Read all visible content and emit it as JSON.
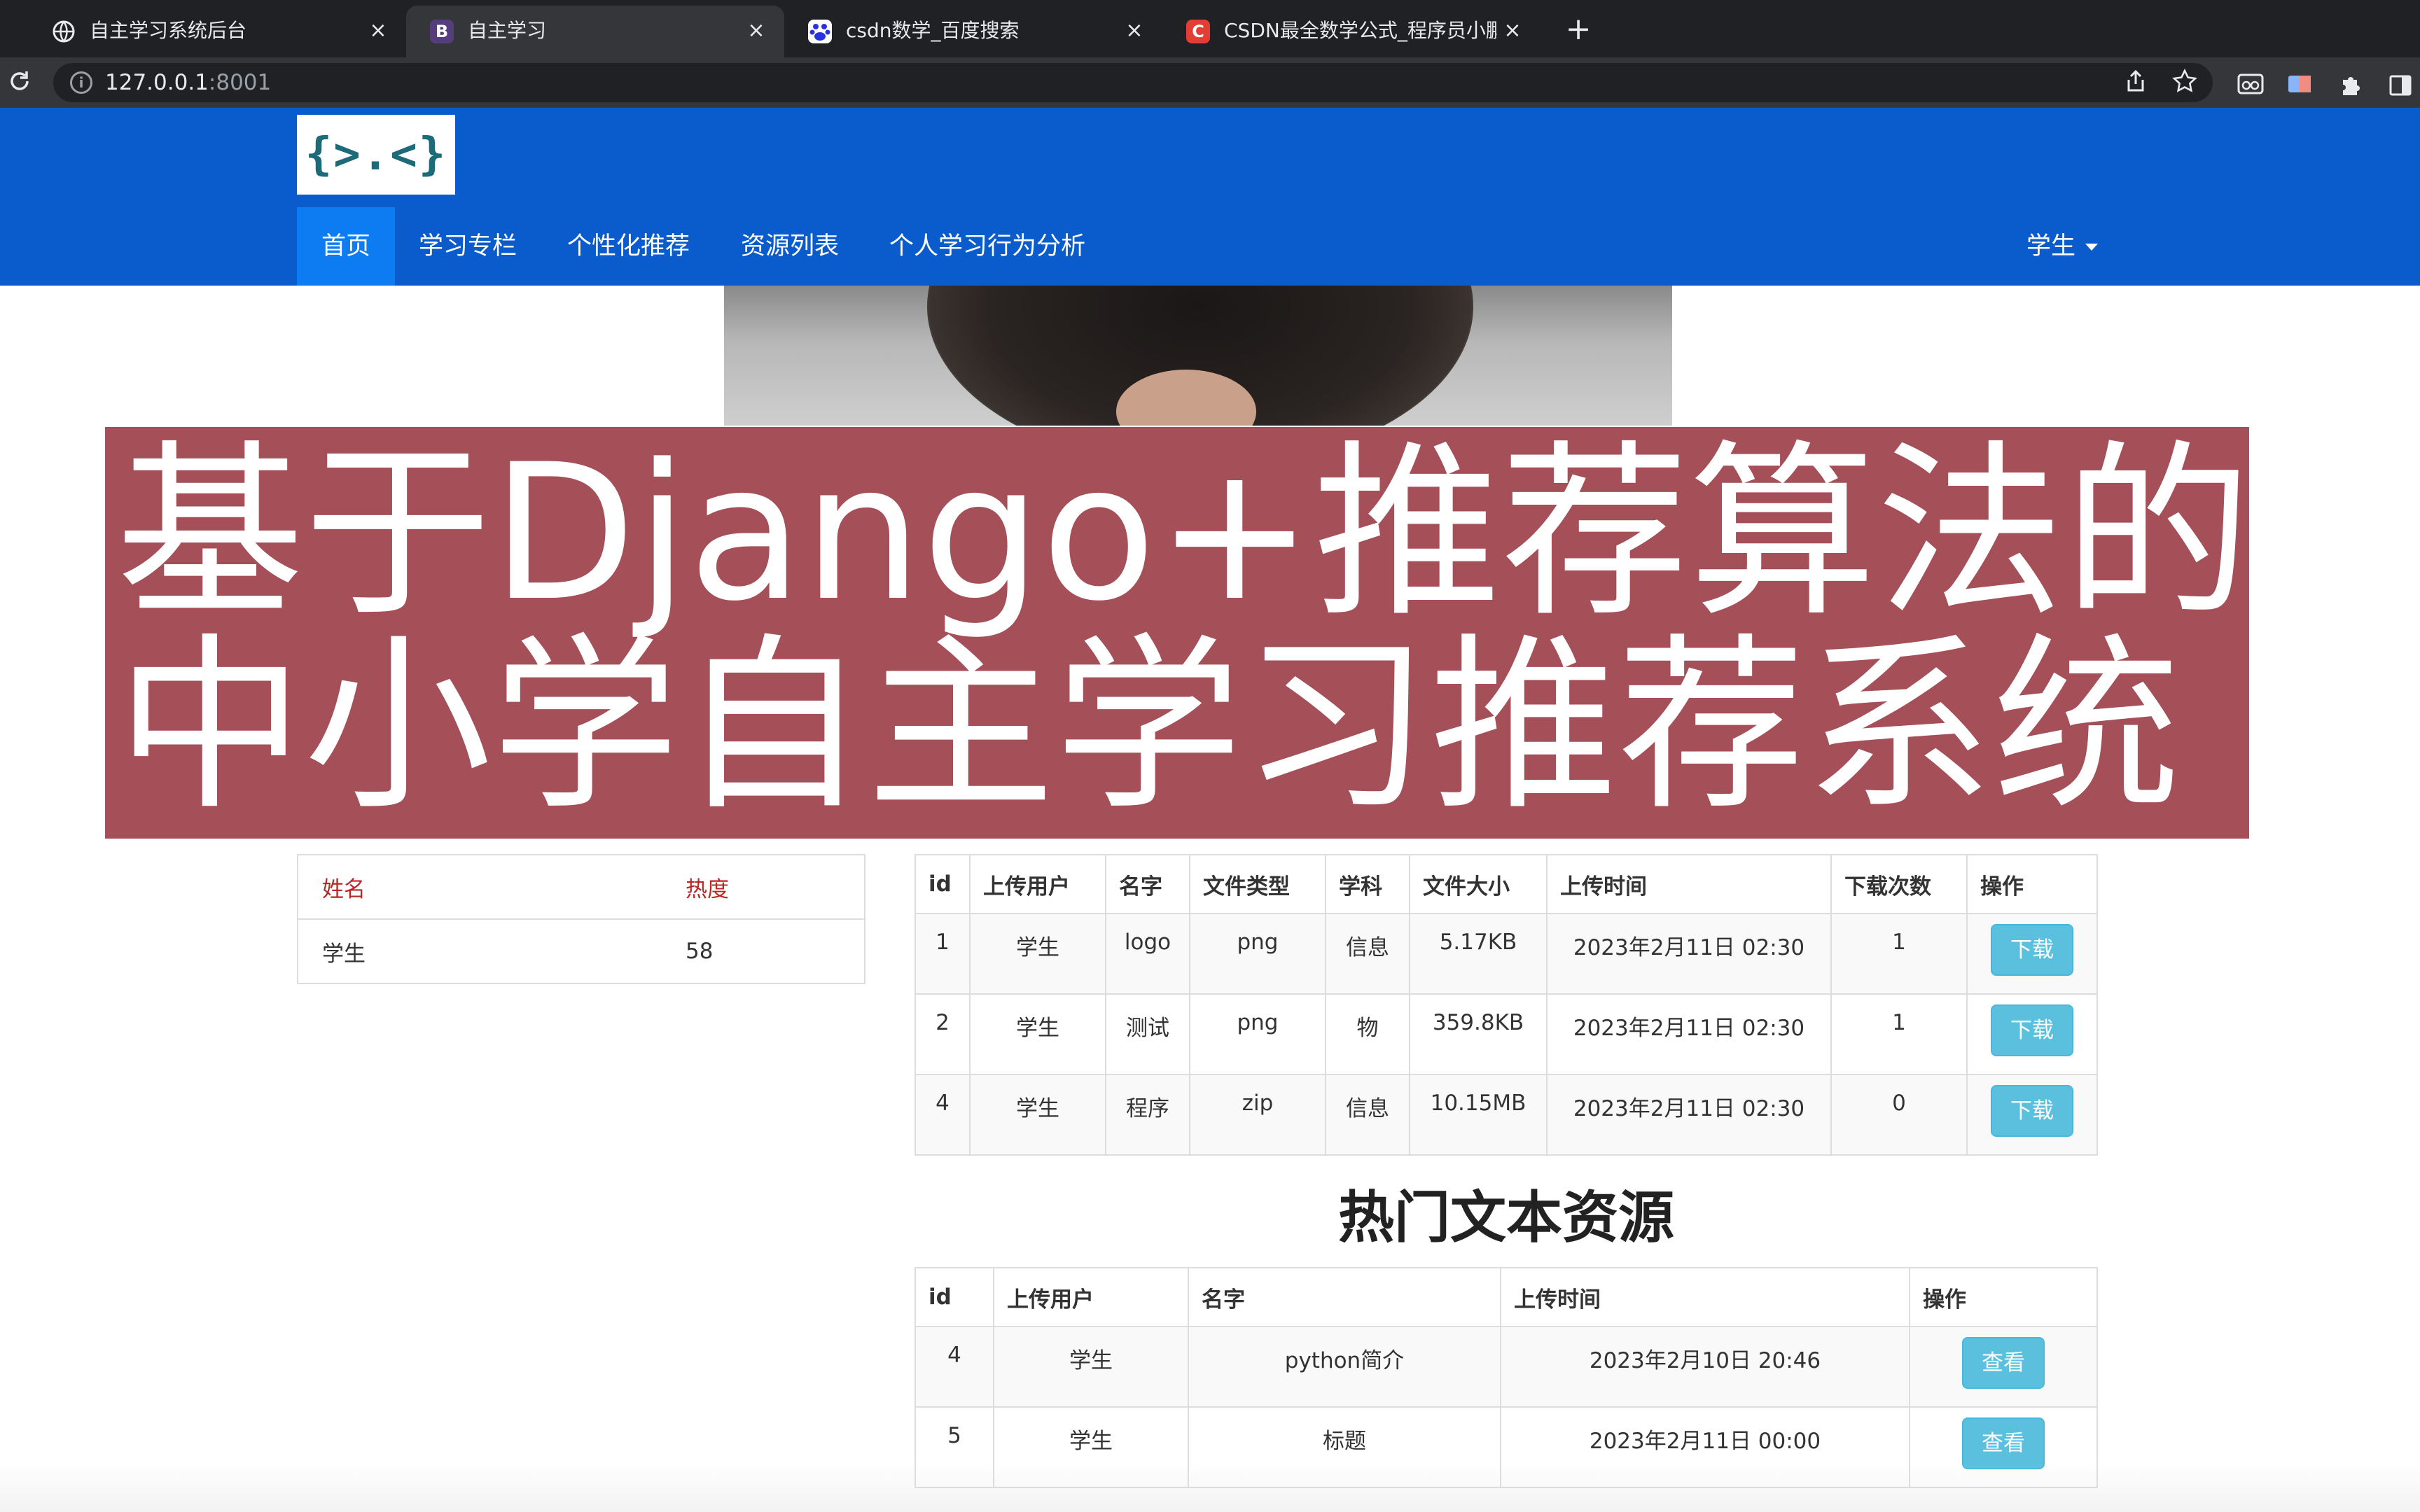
{
  "browser": {
    "tabs": [
      {
        "title": "自主学习系统后台",
        "favicon": "globe-icon",
        "active": false
      },
      {
        "title": "自主学习",
        "favicon": "bootstrap-b-icon",
        "fav_text": "B",
        "active": true
      },
      {
        "title": "csdn数学_百度搜索",
        "favicon": "baidu-paw-icon",
        "active": false
      },
      {
        "title": "CSDN最全数学公式_程序员小鹏",
        "favicon": "csdn-c-icon",
        "fav_text": "C",
        "active": false
      }
    ],
    "close_glyph": "×",
    "new_tab_glyph": "+",
    "url_host": "127.0.0.1",
    "url_port": ":8001"
  },
  "navbar": {
    "logo_text": "{>.<}",
    "items": [
      {
        "label": "首页",
        "active": true
      },
      {
        "label": "学习专栏"
      },
      {
        "label": "个性化推荐"
      },
      {
        "label": "资源列表"
      },
      {
        "label": "个人学习行为分析"
      }
    ],
    "user_menu": "学生"
  },
  "banner": {
    "line1": "基于Django+推荐算法的",
    "line2": "中小学自主学习推荐系统"
  },
  "hot_users": {
    "headers": [
      "姓名",
      "热度"
    ],
    "rows": [
      [
        "学生",
        "58"
      ]
    ]
  },
  "files_table": {
    "headers": [
      "id",
      "上传用户",
      "名字",
      "文件类型",
      "学科",
      "文件大小",
      "上传时间",
      "下载次数",
      "操作"
    ],
    "rows": [
      {
        "id": "1",
        "user": "学生",
        "name": "logo",
        "type": "png",
        "subject": "信息",
        "size": "5.17KB",
        "time": "2023年2月11日 02:30",
        "downloads": "1",
        "action": "下载"
      },
      {
        "id": "2",
        "user": "学生",
        "name": "测试",
        "type": "png",
        "subject": "物",
        "size": "359.8KB",
        "time": "2023年2月11日 02:30",
        "downloads": "1",
        "action": "下载"
      },
      {
        "id": "4",
        "user": "学生",
        "name": "程序",
        "type": "zip",
        "subject": "信息",
        "size": "10.15MB",
        "time": "2023年2月11日 02:30",
        "downloads": "0",
        "action": "下载"
      }
    ]
  },
  "texts_section": {
    "title": "热门文本资源",
    "headers": [
      "id",
      "上传用户",
      "名字",
      "上传时间",
      "操作"
    ],
    "rows": [
      {
        "id": "4",
        "user": "学生",
        "name": "python简介",
        "time": "2023年2月10日 20:46",
        "action": "查看"
      },
      {
        "id": "5",
        "user": "学生",
        "name": "标题",
        "time": "2023年2月11日 00:00",
        "action": "查看"
      }
    ]
  },
  "colors": {
    "navbar": "#0a5ccc",
    "nav_active": "#0d7bf2",
    "banner": "#a54f58",
    "button": "#5bc0de",
    "hot_header": "#b82626"
  }
}
